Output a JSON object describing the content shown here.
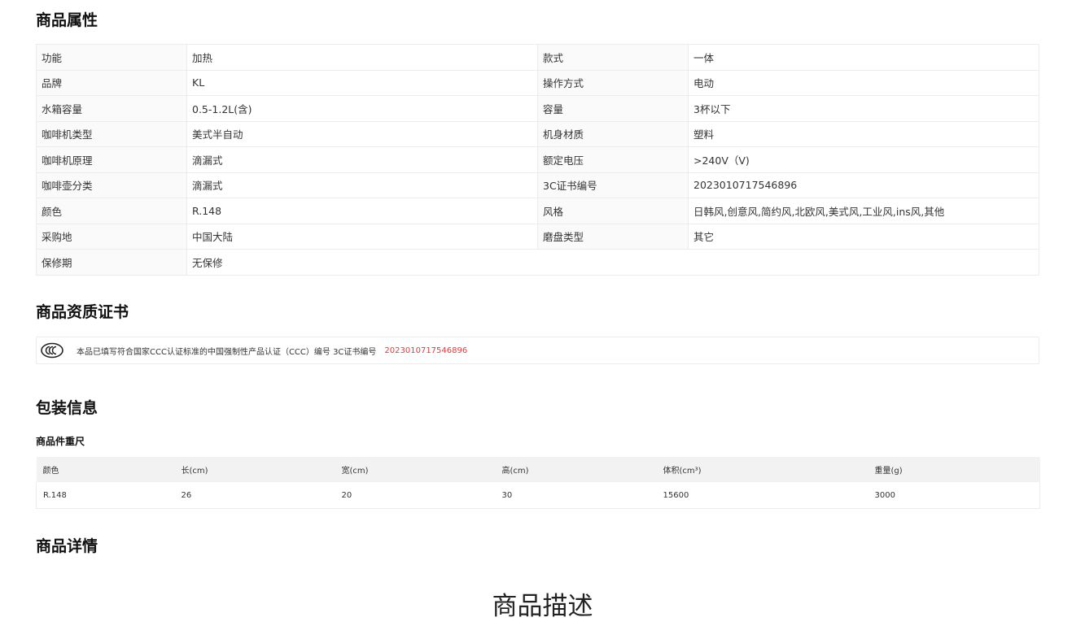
{
  "sections": {
    "attributes_title": "商品属性",
    "certificate_title": "商品资质证书",
    "package_title": "包装信息",
    "detail_title": "商品详情"
  },
  "attributes": [
    {
      "k1": "功能",
      "v1": "加热",
      "k2": "款式",
      "v2": "一体"
    },
    {
      "k1": "品牌",
      "v1": "KL",
      "k2": "操作方式",
      "v2": "电动"
    },
    {
      "k1": "水箱容量",
      "v1": "0.5-1.2L(含)",
      "k2": "容量",
      "v2": "3杯以下"
    },
    {
      "k1": "咖啡机类型",
      "v1": "美式半自动",
      "k2": "机身材质",
      "v2": "塑料"
    },
    {
      "k1": "咖啡机原理",
      "v1": "滴漏式",
      "k2": "额定电压",
      "v2": ">240V（V)"
    },
    {
      "k1": "咖啡壶分类",
      "v1": "滴漏式",
      "k2": "3C证书编号",
      "v2": "2023010717546896"
    },
    {
      "k1": "颜色",
      "v1": "R.148",
      "k2": "风格",
      "v2": "日韩风,创意风,简约风,北欧风,美式风,工业风,ins风,其他"
    },
    {
      "k1": "采购地",
      "v1": "中国大陆",
      "k2": "磨盘类型",
      "v2": "其它"
    },
    {
      "k1": "保修期",
      "v1": "无保修",
      "k2": "",
      "v2": ""
    }
  ],
  "certificate": {
    "icon": "ccc-icon",
    "text": "本品已填写符合国家CCC认证标准的中国强制性产品认证（CCC）编号 3C证书编号",
    "number": "2023010717546896",
    "number_color": "#e4393c"
  },
  "package": {
    "subtitle": "商品件重尺",
    "headers": [
      "颜色",
      "长(cm)",
      "宽(cm)",
      "高(cm)",
      "体积(cm³)",
      "重量(g)"
    ],
    "rows": [
      [
        "R.148",
        "26",
        "20",
        "30",
        "15600",
        "3000"
      ]
    ]
  },
  "detail": {
    "heading": "商品描述"
  }
}
